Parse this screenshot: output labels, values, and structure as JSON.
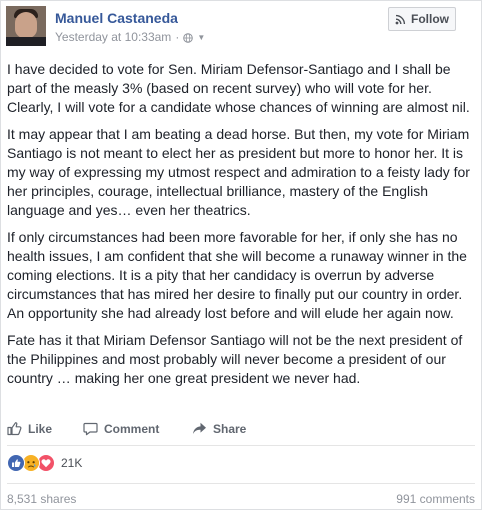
{
  "header": {
    "author": "Manuel Castaneda",
    "timestamp": "Yesterday at 10:33am",
    "separator": "·",
    "privacy_icon": "globe-icon",
    "follow_label": "Follow",
    "follow_icon": "rss-icon"
  },
  "post": {
    "paragraphs": [
      "I have decided to vote for Sen. Miriam Defensor-Santiago and I shall be part of the measly 3% (based on recent survey) who will vote for her. Clearly, I will vote for a candidate whose chances of winning are almost nil.",
      "It may appear that I am beating a dead horse. But then, my vote for Miriam Santiago is not meant to elect her as president but more to honor her. It is my way of expressing my utmost respect and admiration to a feisty lady for her principles, courage, intellectual brilliance, mastery of the English language and yes… even her theatrics.",
      "If only circumstances had been more favorable for her, if only she has no health issues, I am confident that she will become a runaway winner in the coming elections. It is a pity that her candidacy is overrun by adverse circumstances that has mired her desire to finally put our country in order. An opportunity she had already lost before and will elude her again now.",
      "Fate has it that Miriam Defensor Santiago will not be the next president of the Philippines and most probably will never become a president of our country … making her one great president we never had."
    ]
  },
  "actions": {
    "like": "Like",
    "comment": "Comment",
    "share": "Share"
  },
  "reactions": {
    "icons": [
      "like-reaction-icon",
      "sad-reaction-icon",
      "love-reaction-icon"
    ],
    "count": "21K"
  },
  "footer": {
    "shares": "8,531 shares",
    "comments": "991 comments"
  },
  "colors": {
    "link_blue": "#365899",
    "like_blue": "#4267b2",
    "love_red": "#f25268",
    "sad_yellow": "#f7b125",
    "meta_gray": "#90949c"
  }
}
